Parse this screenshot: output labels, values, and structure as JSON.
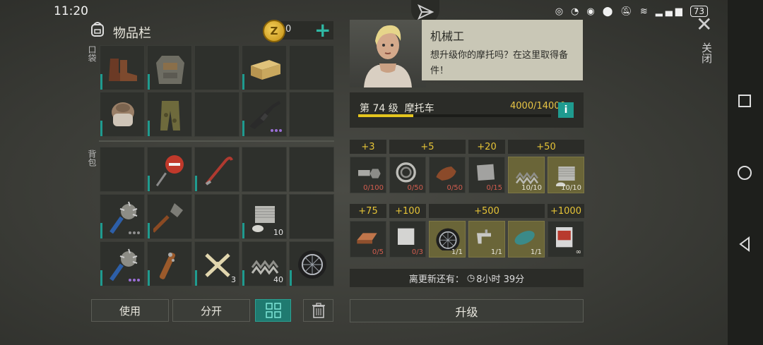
{
  "status_bar": {
    "time": "11:20",
    "battery": "73",
    "icons": [
      "data-saver-icon",
      "speedometer-icon",
      "eye-icon",
      "location-icon",
      "mute-icon",
      "wifi-icon",
      "signal-icon"
    ]
  },
  "header": {
    "close_label": "关闭"
  },
  "inventory": {
    "title": "物品栏",
    "coins": "0",
    "pockets_label": "口袋",
    "backpack_label": "背包",
    "pocket_slots": [
      {
        "item": "boots-icon",
        "count": ""
      },
      {
        "item": "armor-vest-icon",
        "count": ""
      },
      {
        "item": "empty",
        "count": ""
      },
      {
        "item": "ammo-crate-icon",
        "count": ""
      },
      {
        "item": "empty",
        "count": ""
      },
      {
        "item": "fur-hat-icon",
        "count": ""
      },
      {
        "item": "camo-pants-icon",
        "count": ""
      },
      {
        "item": "empty",
        "count": ""
      },
      {
        "item": "assault-rifle-icon",
        "count": ""
      },
      {
        "item": "empty",
        "count": ""
      }
    ],
    "backpack_slots": [
      {
        "item": "empty",
        "count": ""
      },
      {
        "item": "stop-sign-icon",
        "count": ""
      },
      {
        "item": "crowbar-icon",
        "count": ""
      },
      {
        "item": "empty",
        "count": ""
      },
      {
        "item": "empty",
        "count": ""
      },
      {
        "item": "spiked-mace-icon",
        "count": ""
      },
      {
        "item": "shovel-icon",
        "count": ""
      },
      {
        "item": "empty",
        "count": ""
      },
      {
        "item": "engine-cylinder-icon",
        "count": "10"
      },
      {
        "item": "empty",
        "count": ""
      },
      {
        "item": "spiked-mace-icon",
        "count": ""
      },
      {
        "item": "nail-bat-icon",
        "count": ""
      },
      {
        "item": "bones-icon",
        "count": "3"
      },
      {
        "item": "spring-icon",
        "count": "40"
      },
      {
        "item": "wheel-icon",
        "count": ""
      }
    ],
    "buttons": {
      "use": "使用",
      "split": "分开"
    },
    "sort_icon": "grid-sort-icon",
    "trash_icon": "trash-icon"
  },
  "mechanic": {
    "name": "机械工",
    "message": "想升级你的摩托吗？在这里取得备件！",
    "level_label": "第 74 级  摩托车",
    "progress_text": "4000/14000",
    "progress_fraction": 0.2857,
    "info_label": "i",
    "tiers_row1": [
      {
        "bonus": "+3",
        "parts": [
          {
            "icon": "bolt-nut-icon",
            "count": "0/100",
            "done": false
          }
        ]
      },
      {
        "bonus": "+5",
        "parts": [
          {
            "icon": "bearing-icon",
            "count": "0/50",
            "done": false
          },
          {
            "icon": "leather-icon",
            "count": "0/50",
            "done": false
          }
        ]
      },
      {
        "bonus": "+20",
        "parts": [
          {
            "icon": "metal-plate-icon",
            "count": "0/15",
            "done": false
          }
        ]
      },
      {
        "bonus": "+50",
        "parts": [
          {
            "icon": "spring-icon",
            "count": "10/10",
            "done": true
          },
          {
            "icon": "engine-cylinder-icon",
            "count": "10/10",
            "done": true
          }
        ]
      }
    ],
    "tiers_row2": [
      {
        "bonus": "+75",
        "parts": [
          {
            "icon": "copper-ingot-icon",
            "count": "0/5",
            "done": false
          }
        ]
      },
      {
        "bonus": "+100",
        "parts": [
          {
            "icon": "steel-sheet-icon",
            "count": "0/3",
            "done": false
          }
        ]
      },
      {
        "bonus": "+500",
        "parts": [
          {
            "icon": "wheel-icon",
            "count": "1/1",
            "done": true
          },
          {
            "icon": "faucet-icon",
            "count": "1/1",
            "done": true
          },
          {
            "icon": "fuel-tank-icon",
            "count": "1/1",
            "done": true
          }
        ]
      },
      {
        "bonus": "+1000",
        "parts": [
          {
            "icon": "manual-book-icon",
            "count": "∞",
            "done": false
          }
        ]
      }
    ],
    "update_text": "离更新还有：",
    "update_time": "8小时 39分",
    "upgrade_button": "升级"
  }
}
